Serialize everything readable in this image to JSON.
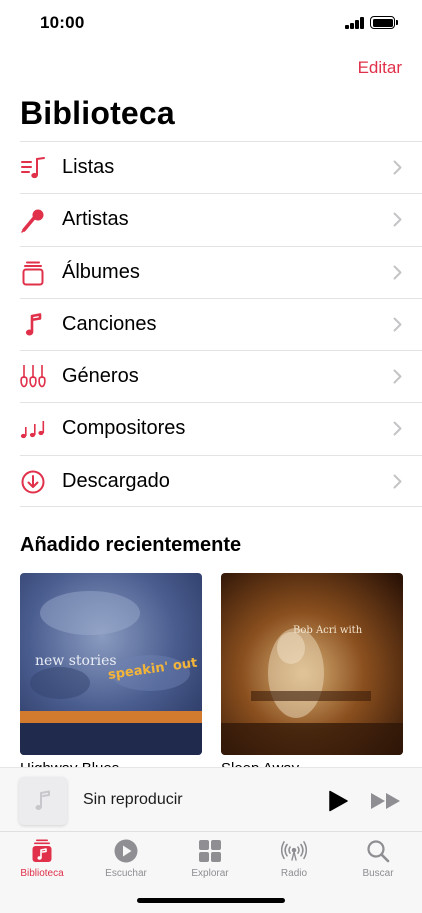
{
  "status_bar": {
    "time": "10:00"
  },
  "header": {
    "edit_label": "Editar",
    "title": "Biblioteca"
  },
  "library": {
    "items": [
      {
        "label": "Listas",
        "icon": "playlist-icon"
      },
      {
        "label": "Artistas",
        "icon": "microphone-icon"
      },
      {
        "label": "Álbumes",
        "icon": "album-stack-icon"
      },
      {
        "label": "Canciones",
        "icon": "music-note-icon"
      },
      {
        "label": "Géneros",
        "icon": "guitars-icon"
      },
      {
        "label": "Compositores",
        "icon": "music-notes-icon"
      },
      {
        "label": "Descargado",
        "icon": "download-circle-icon"
      }
    ]
  },
  "recent": {
    "title": "Añadido recientemente",
    "albums": [
      {
        "caption": "Highway Blues",
        "cover_text_1": "new stories",
        "cover_text_2": "speakin' out"
      },
      {
        "caption": "Sleep Away",
        "cover_text_1": "Bob Acri with"
      }
    ]
  },
  "player": {
    "title": "Sin reproducir"
  },
  "tabs": [
    {
      "label": "Biblioteca",
      "icon": "library-icon",
      "active": true
    },
    {
      "label": "Escuchar",
      "icon": "play-circle-icon",
      "active": false
    },
    {
      "label": "Explorar",
      "icon": "grid-icon",
      "active": false
    },
    {
      "label": "Radio",
      "icon": "radio-waves-icon",
      "active": false
    },
    {
      "label": "Buscar",
      "icon": "search-icon",
      "active": false
    }
  ],
  "colors": {
    "accent": "#e0304a",
    "inactive": "#8e8e93"
  }
}
